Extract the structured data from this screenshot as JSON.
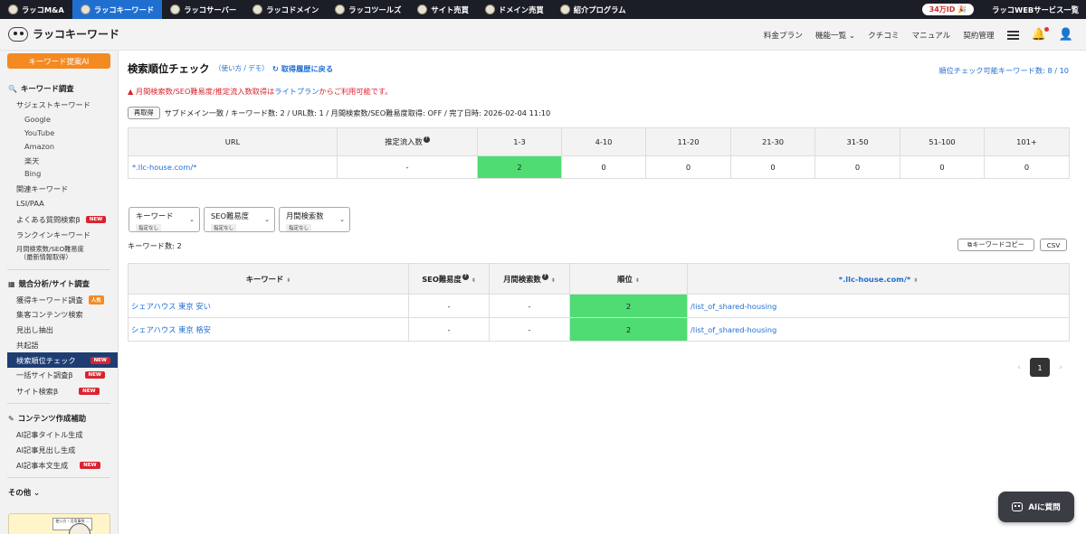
{
  "topbar": {
    "tabs": [
      {
        "label": "ラッコM&A"
      },
      {
        "label": "ラッコキーワード"
      },
      {
        "label": "ラッコサーバー"
      },
      {
        "label": "ラッコドメイン"
      },
      {
        "label": "ラッコツールズ"
      },
      {
        "label": "サイト売買"
      },
      {
        "label": "ドメイン売買"
      },
      {
        "label": "紹介プログラム"
      }
    ],
    "id_badge": "34万ID 🎉",
    "services_link": "ラッコWEBサービス一覧"
  },
  "header": {
    "logo": "ラッコキーワード",
    "nav": [
      "料金プラン",
      "機能一覧 ⌄",
      "クチコミ",
      "マニュアル",
      "契約管理"
    ]
  },
  "sidebar": {
    "ai_button": "キーワード提案AI",
    "sec1": "キーワード調査",
    "suggest": "サジェストキーワード",
    "sub": [
      "Google",
      "YouTube",
      "Amazon",
      "楽天",
      "Bing"
    ],
    "related": "関連キーワード",
    "lsi": "LSI/PAA",
    "faq": "よくある質問検索β",
    "rankin": "ランクインキーワード",
    "volume1": "月間検索数/SEO難易度",
    "volume2": "（最新情報取得）",
    "sec2": "競合分析/サイト調査",
    "acquired": "獲得キーワード調査",
    "popular_badge": "人気",
    "contents": "集客コンテンツ検索",
    "headings": "見出し抽出",
    "cooccur": "共起語",
    "rank_check": "検索順位チェック",
    "bulk": "一括サイト調査β",
    "site_search": "サイト検索β",
    "sec3": "コンテンツ作成補助",
    "ai_title": "AI記事タイトル生成",
    "ai_heading": "AI記事見出し生成",
    "ai_body": "AI記事本文生成",
    "new_badge": "NEW",
    "other": "その他 ⌄",
    "promo_note": "使い方・活用事例 …"
  },
  "main": {
    "title": "検索順位チェック",
    "usage": "（使い方 / デモ）",
    "back": "取得履歴に戻る",
    "quota": "順位チェック可能キーワード数: 8 / 10",
    "warn_prefix": "月間検索数/SEO難易度/推定流入数取得は",
    "warn_link": "ライトプラン",
    "warn_suffix": "からご利用可能です。",
    "refetch": "再取得",
    "meta": "サブドメイン一致 / キーワード数: 2 / URL数: 1 / 月間検索数/SEO難易度取得: OFF / 完了日時: 2026-02-04 11:10"
  },
  "summary": {
    "headers": [
      "URL",
      "推定流入数",
      "1-3",
      "4-10",
      "11-20",
      "21-30",
      "31-50",
      "51-100",
      "101+"
    ],
    "row": {
      "url": "*.llc-house.com/*",
      "traffic": "-",
      "counts": [
        "2",
        "0",
        "0",
        "0",
        "0",
        "0",
        "0"
      ]
    }
  },
  "filters": [
    {
      "label": "キーワード",
      "state": "指定なし"
    },
    {
      "label": "SEO難易度",
      "state": "指定なし"
    },
    {
      "label": "月間検索数",
      "state": "指定なし"
    }
  ],
  "keyword_count": "キーワード数: 2",
  "copy_button": "キーワードコピー",
  "csv_button": "CSV",
  "results": {
    "headers": [
      "キーワード",
      "SEO難易度",
      "月間検索数",
      "順位",
      "*.llc-house.com/*"
    ],
    "rows": [
      {
        "keyword": "シェアハウス 東京 安い",
        "seo": "-",
        "volume": "-",
        "rank": "2",
        "page": "/list_of_shared-housing"
      },
      {
        "keyword": "シェアハウス 東京 格安",
        "seo": "-",
        "volume": "-",
        "rank": "2",
        "page": "/list_of_shared-housing"
      }
    ]
  },
  "pager": {
    "current": "1",
    "prev": "‹",
    "next": "›"
  },
  "ai_chat": "AIに質問",
  "colors": {
    "accent": "#1f6fd1",
    "highlight": "#4fdc73",
    "cta": "#f48a21",
    "danger": "#d9242f"
  }
}
